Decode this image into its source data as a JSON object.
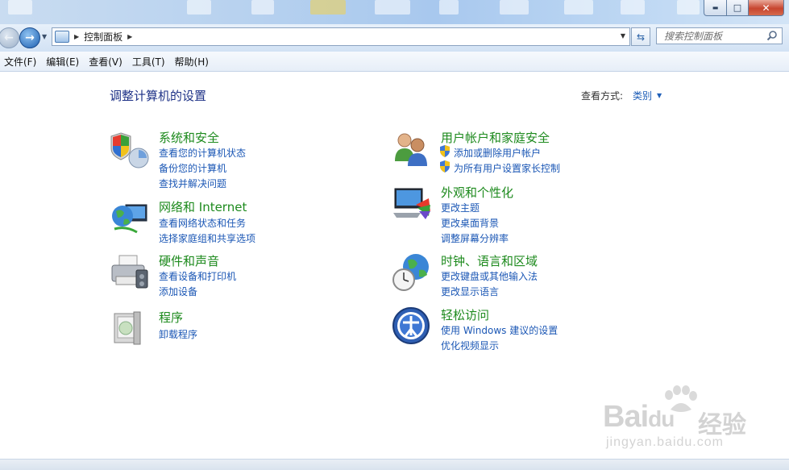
{
  "window": {
    "controls": {
      "minimize": "▬",
      "maximize": "□",
      "close": "✕"
    }
  },
  "nav": {
    "breadcrumb": "控制面板",
    "search_placeholder": "搜索控制面板"
  },
  "menu": [
    "文件(F)",
    "编辑(E)",
    "查看(V)",
    "工具(T)",
    "帮助(H)"
  ],
  "page": {
    "title": "调整计算机的设置",
    "view_by_label": "查看方式:",
    "view_by_value": "类别"
  },
  "categories": [
    {
      "icon": "shield-security-icon",
      "title": "系统和安全",
      "links": [
        "查看您的计算机状态",
        "备份您的计算机",
        "查找并解决问题"
      ]
    },
    {
      "icon": "network-globe-icon",
      "title": "网络和 Internet",
      "links": [
        "查看网络状态和任务",
        "选择家庭组和共享选项"
      ]
    },
    {
      "icon": "printer-icon",
      "title": "硬件和声音",
      "links": [
        "查看设备和打印机",
        "添加设备"
      ]
    },
    {
      "icon": "programs-box-icon",
      "title": "程序",
      "links": [
        "卸载程序"
      ]
    },
    {
      "icon": "users-icon",
      "title": "用户帐户和家庭安全",
      "links": [
        "添加或删除用户帐户",
        "为所有用户设置家长控制"
      ]
    },
    {
      "icon": "appearance-monitor-icon",
      "title": "外观和个性化",
      "links": [
        "更改主题",
        "更改桌面背景",
        "调整屏幕分辨率"
      ]
    },
    {
      "icon": "clock-globe-icon",
      "title": "时钟、语言和区域",
      "links": [
        "更改键盘或其他输入法",
        "更改显示语言"
      ]
    },
    {
      "icon": "ease-of-access-icon",
      "title": "轻松访问",
      "links": [
        "使用 Windows 建议的设置",
        "优化视频显示"
      ]
    }
  ],
  "watermark": {
    "brand": "Bai",
    "brand2": "du",
    "cn": "经验",
    "url": "jingyan.baidu.com"
  }
}
